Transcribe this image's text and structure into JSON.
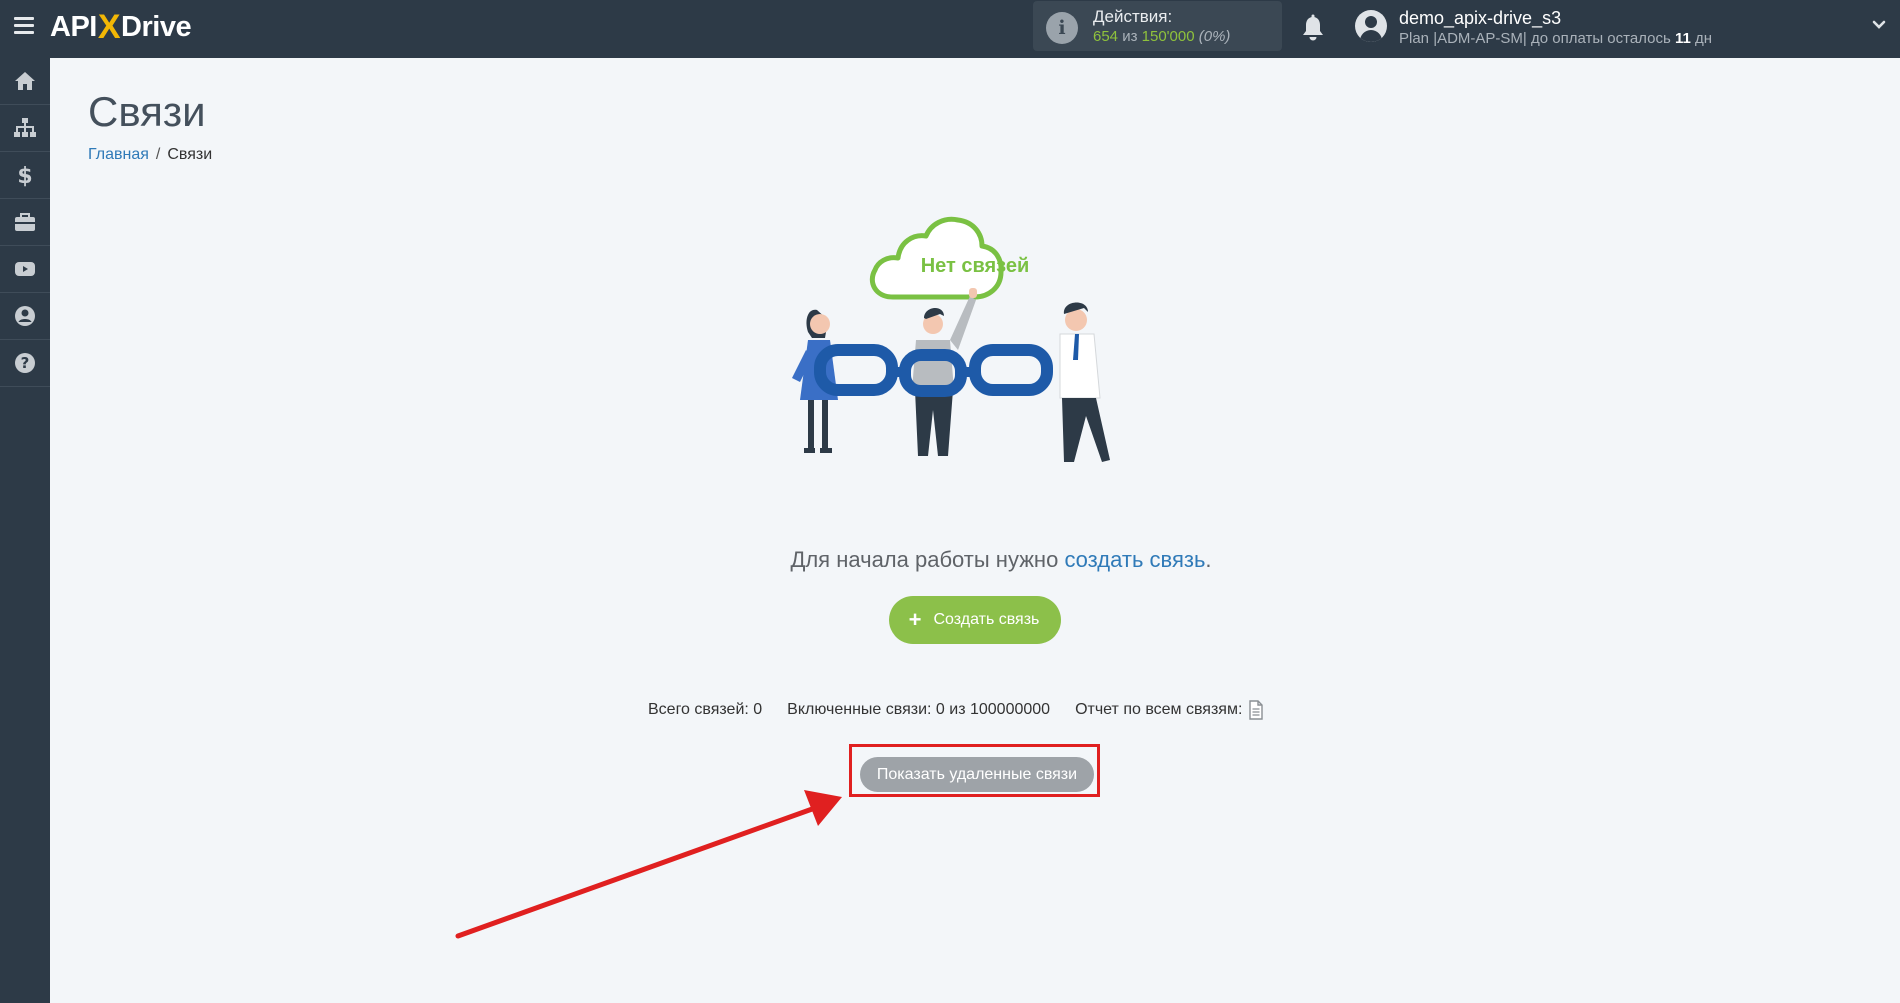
{
  "app": {
    "logo_left": "API",
    "logo_x": "X",
    "logo_right": "Drive"
  },
  "header": {
    "actions_label": "Действия:",
    "actions_used": "654",
    "actions_of": "из",
    "actions_total": "150'000",
    "actions_percent": "(0%)",
    "user_name": "demo_apix-drive_s3",
    "plan_text": "Plan |ADM-AP-SM| до оплаты осталось",
    "days_left": "11",
    "days_unit": "дн"
  },
  "sidebar": {
    "items": [
      "home-icon",
      "sitemap-icon",
      "dollar-icon",
      "briefcase-icon",
      "youtube-icon",
      "user-circle-icon",
      "help-icon"
    ]
  },
  "page": {
    "title": "Связи",
    "breadcrumb_home": "Главная",
    "breadcrumb_sep": "/",
    "breadcrumb_current": "Связи"
  },
  "empty_state": {
    "cloud_label": "Нет связей",
    "text_before": "Для начала работы нужно",
    "text_link": "создать связь",
    "text_after": ".",
    "create_button": "Создать связь",
    "create_plus": "+"
  },
  "stats": {
    "total": "Всего связей: 0",
    "enabled": "Включенные связи: 0 из 100000000",
    "report": "Отчет по всем связям:"
  },
  "deleted_button": "Показать удаленные связи",
  "colors": {
    "header_bg": "#2d3a47",
    "accent_green": "#8cc04a",
    "link_blue": "#2f7ab8",
    "annotation_red": "#e02020",
    "chain_blue": "#1e5aa8"
  }
}
